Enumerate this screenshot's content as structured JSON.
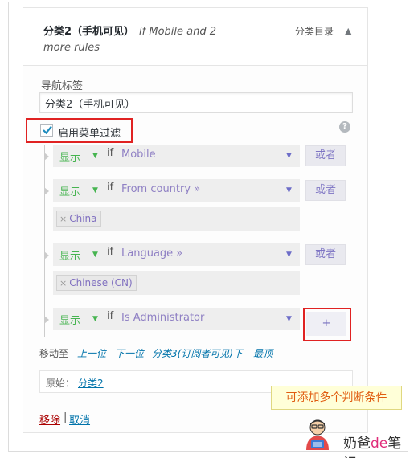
{
  "menu_item": {
    "title": "分类2（手机可见）",
    "rules_summary_line1": "if Mobile and 2",
    "rules_summary_line2": "more rules",
    "type_label": "分类目录",
    "toggle_icon": "triangle-up-icon"
  },
  "nav_label": {
    "label": "导航标签",
    "value": "分类2（手机可见）"
  },
  "filter": {
    "checkbox_label": "启用菜单过滤",
    "checked": true,
    "help_icon": "?"
  },
  "rules": [
    {
      "condition": "显示",
      "if": "if",
      "rule": "Mobile",
      "or_button": "或者",
      "values": []
    },
    {
      "condition": "显示",
      "if": "if",
      "rule": "From country »",
      "or_button": "或者",
      "values": [
        "China"
      ]
    },
    {
      "condition": "显示",
      "if": "if",
      "rule": "Language »",
      "or_button": "或者",
      "values": [
        "Chinese (CN)"
      ]
    },
    {
      "condition": "显示",
      "if": "if",
      "rule": "Is Administrator",
      "add_button": "+",
      "values": []
    }
  ],
  "tag_remove": "×",
  "move": {
    "label": "移动至",
    "up": "上一位",
    "down": "下一位",
    "under": "分类3(订阅者可见)下",
    "top": "最顶"
  },
  "original": {
    "label": "原始：",
    "link": "分类2"
  },
  "actions": {
    "remove": "移除",
    "separator": "|",
    "cancel": "取消"
  },
  "annotation": "可添加多个判断条件",
  "brand": {
    "part1": "奶爸",
    "part2": "de",
    "part3": "笔记"
  },
  "colors": {
    "condition_green": "#46b450",
    "rule_purple": "#8f80c4",
    "highlight_red": "#e02222",
    "link_blue": "#0073aa",
    "remove_red": "#aa0000",
    "note_orange": "#e05c10"
  }
}
